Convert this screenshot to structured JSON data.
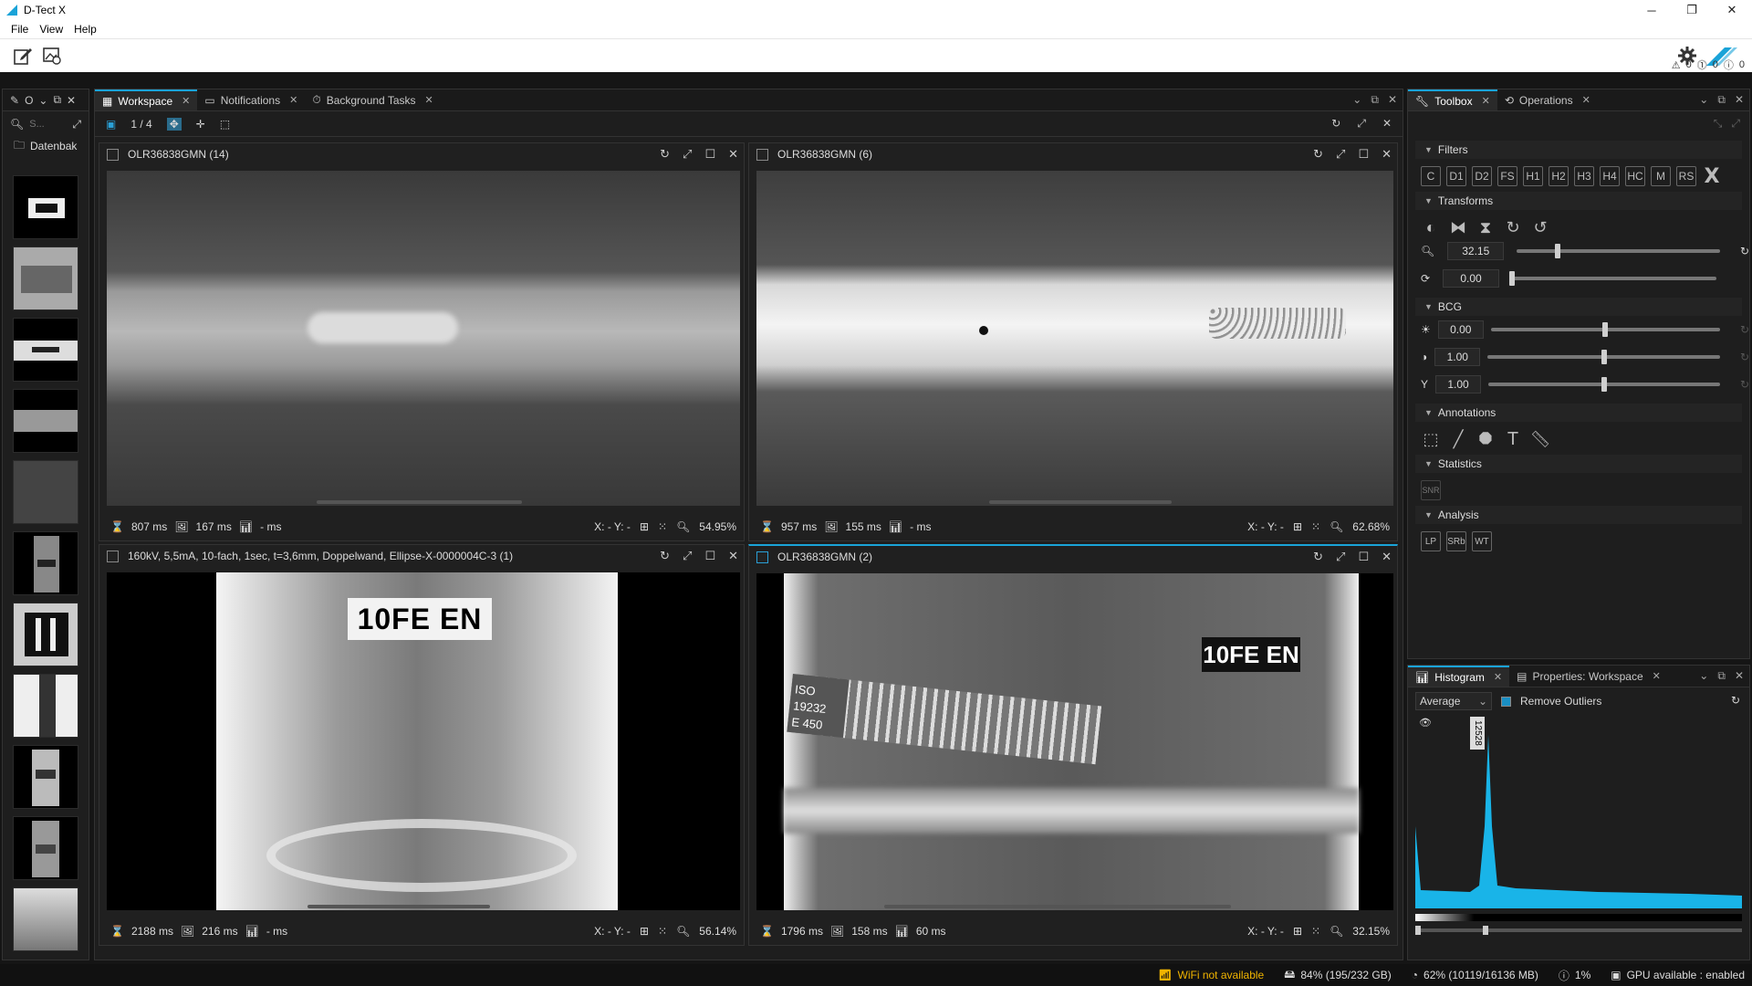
{
  "window": {
    "title": "D-Tect X",
    "minimize": "─",
    "restore": "❐",
    "close": "✕"
  },
  "menu": [
    "File",
    "View",
    "Help"
  ],
  "notifications": {
    "warnings": "0",
    "errors": "0",
    "infos": "0"
  },
  "left_panel": {
    "search_placeholder": "S...",
    "folder_label": "Datenbak",
    "tab_label": "O"
  },
  "workspace_tabs": [
    {
      "label": "Workspace",
      "active": true
    },
    {
      "label": "Notifications",
      "active": false
    },
    {
      "label": "Background Tasks",
      "active": false
    }
  ],
  "workspace": {
    "page": "1 / 4"
  },
  "viewers": [
    {
      "title": "OLR36838GMN (14)",
      "t1": "807 ms",
      "t2": "167 ms",
      "t3": "- ms",
      "xy": "X: -  Y: -",
      "zoom": "54.95%",
      "selected": false
    },
    {
      "title": "OLR36838GMN (6)",
      "t1": "957 ms",
      "t2": "155 ms",
      "t3": "- ms",
      "xy": "X: -  Y: -",
      "zoom": "62.68%",
      "selected": false
    },
    {
      "title": "160kV, 5,5mA, 10-fach, 1sec, t=3,6mm, Doppelwand, Ellipse-X-0000004C-3 (1)",
      "t1": "2188 ms",
      "t2": "216 ms",
      "t3": "- ms",
      "xy": "X: -  Y: -",
      "zoom": "56.14%",
      "selected": false
    },
    {
      "title": "OLR36838GMN (2)",
      "t1": "1796 ms",
      "t2": "158 ms",
      "t3": "60 ms",
      "xy": "X: -  Y: -",
      "zoom": "32.15%",
      "selected": true
    }
  ],
  "image_text": {
    "plate": "10FE EN",
    "plate2": "10FE EN",
    "iso": "ISO 19232",
    "iso2": "E 450"
  },
  "toolbox_tabs": [
    {
      "label": "Toolbox",
      "active": true
    },
    {
      "label": "Operations",
      "active": false
    }
  ],
  "filters": {
    "title": "Filters",
    "buttons": [
      "C",
      "D1",
      "D2",
      "FS",
      "H1",
      "H2",
      "H3",
      "H4",
      "HC",
      "M",
      "RS"
    ]
  },
  "transforms": {
    "title": "Transforms",
    "zoom": "32.15",
    "rotation": "0.00",
    "zoom_level": 0.2,
    "rotation_level": 0.0
  },
  "bcg": {
    "title": "BCG",
    "brightness": "0.00",
    "contrast": "1.00",
    "gamma": "1.00",
    "brightness_level": 0.5,
    "contrast_level": 0.5,
    "gamma_level": 0.5
  },
  "annotations": {
    "title": "Annotations"
  },
  "statistics": {
    "title": "Statistics",
    "snr": "SNR"
  },
  "analysis": {
    "title": "Analysis",
    "buttons": [
      "LP",
      "SRb",
      "WT"
    ]
  },
  "hist_tabs": [
    {
      "label": "Histogram",
      "active": true
    },
    {
      "label": "Properties: Workspace",
      "active": false
    }
  ],
  "histogram": {
    "mode": "Average",
    "remove_outliers": "Remove Outliers",
    "peak_label": "12528",
    "remove_outliers_checked": true
  },
  "status": {
    "wifi": "WiFi not available",
    "disk": "84% (195/232 GB)",
    "memory": "62% (10119/16136 MB)",
    "cpu": "1%",
    "gpu": "GPU available : enabled"
  },
  "colors": {
    "accent": "#1aa3d8",
    "warn": "#f0b400",
    "hist": "#19b4e8"
  }
}
